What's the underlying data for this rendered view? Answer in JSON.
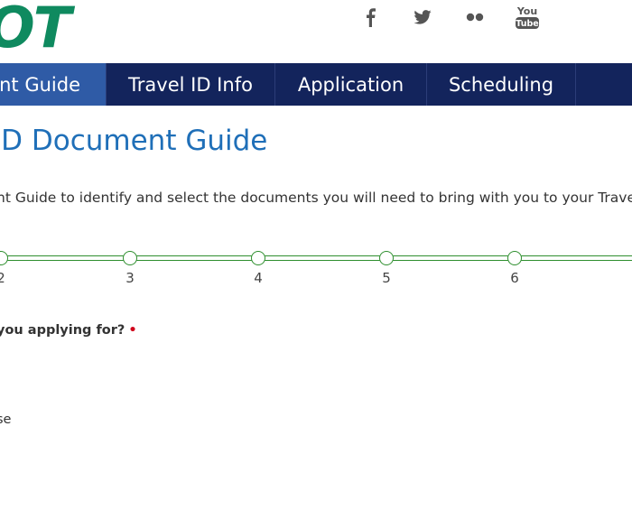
{
  "header": {
    "logo_text": "OT",
    "social": [
      {
        "icon": "facebook-icon"
      },
      {
        "icon": "twitter-icon"
      },
      {
        "icon": "flickr-icon"
      },
      {
        "icon": "youtube-icon",
        "label_top": "You",
        "label_bottom": "Tube"
      }
    ]
  },
  "nav": {
    "items": [
      {
        "label": "ent Guide",
        "active": true
      },
      {
        "label": "Travel ID Info",
        "active": false
      },
      {
        "label": "Application",
        "active": false
      },
      {
        "label": "Scheduling",
        "active": false
      },
      {
        "label": "",
        "active": false
      }
    ]
  },
  "main": {
    "title": "ID Document Guide",
    "intro": "nt Guide to identify and select the documents you will need to bring with you to your Travel II",
    "steps": [
      "2",
      "3",
      "4",
      "5",
      "6"
    ],
    "question": "you applying for?",
    "required_marker": "•",
    "option_label": "se"
  },
  "colors": {
    "nav_bg": "#13245c",
    "nav_active": "#2f5ba6",
    "title": "#1f6fb8",
    "progress": "#2f8f2f",
    "logo": "#0f8a5f",
    "required": "#d0021b"
  }
}
